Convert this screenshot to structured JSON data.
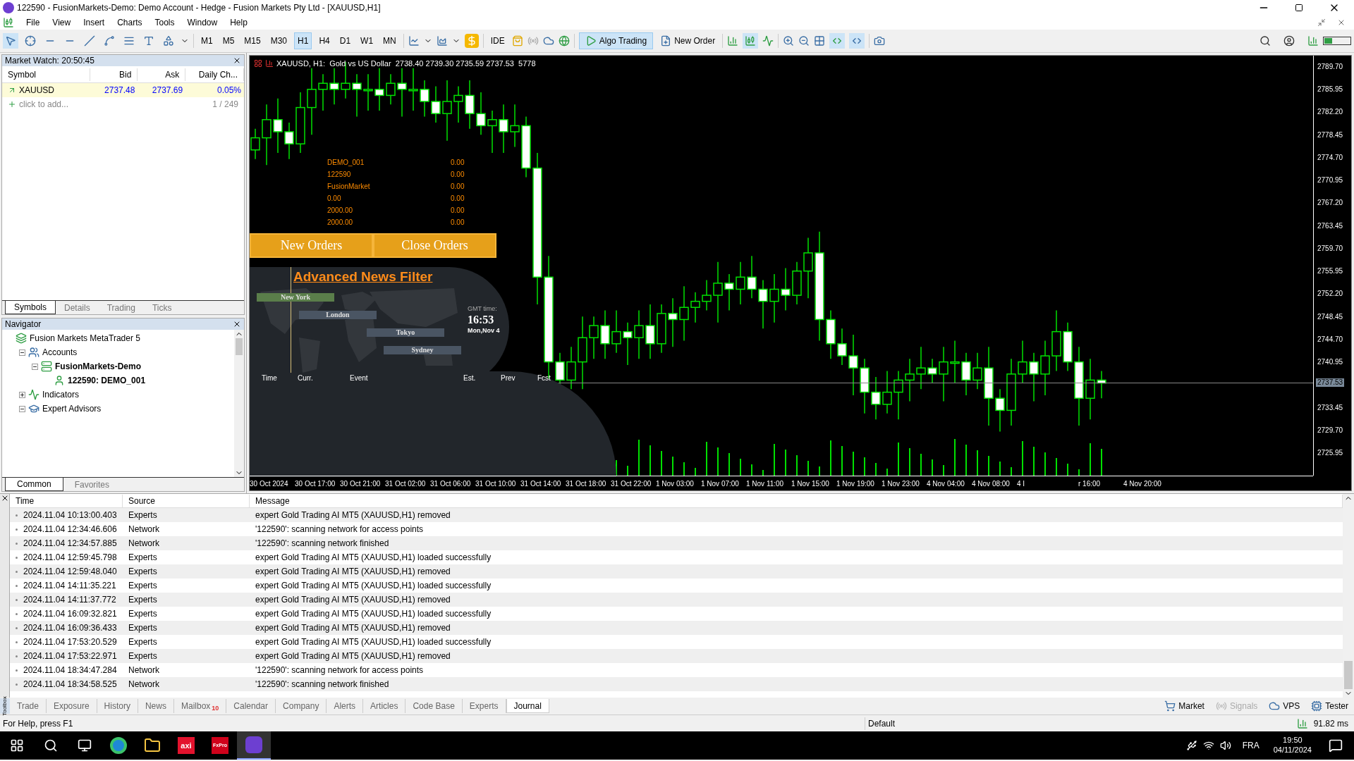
{
  "window": {
    "title": "122590 - FusionMarkets-Demo: Demo Account - Hedge - Fusion Markets Pty Ltd - [XAUUSD,H1]"
  },
  "menu": [
    "File",
    "View",
    "Insert",
    "Charts",
    "Tools",
    "Window",
    "Help"
  ],
  "toolbar": {
    "timeframes": [
      {
        "label": "M1",
        "selected": false
      },
      {
        "label": "M5",
        "selected": false
      },
      {
        "label": "M15",
        "selected": false
      },
      {
        "label": "M30",
        "selected": false
      },
      {
        "label": "H1",
        "selected": true
      },
      {
        "label": "H4",
        "selected": false
      },
      {
        "label": "D1",
        "selected": false
      },
      {
        "label": "W1",
        "selected": false
      },
      {
        "label": "MN",
        "selected": false
      }
    ],
    "ide": "IDE",
    "algo_trading": {
      "label": "Algo Trading",
      "on": true
    },
    "new_order": "New Order"
  },
  "market_watch": {
    "title": "Market Watch: 20:50:45",
    "columns": [
      "Symbol",
      "Bid",
      "Ask",
      "Daily Ch..."
    ],
    "rows": [
      {
        "symbol": "XAUUSD",
        "bid": "2737.48",
        "ask": "2737.69",
        "change": "0.05%"
      }
    ],
    "add_label": "click to add...",
    "count": "1 / 249",
    "tabs": [
      {
        "label": "Symbols",
        "selected": true
      },
      {
        "label": "Details",
        "selected": false
      },
      {
        "label": "Trading",
        "selected": false
      },
      {
        "label": "Ticks",
        "selected": false
      }
    ]
  },
  "navigator": {
    "title": "Navigator",
    "tree": [
      {
        "label": "Fusion Markets MetaTrader 5",
        "kind": "terminal",
        "bold": false
      },
      {
        "label": "Accounts",
        "kind": "accounts",
        "expanded": true,
        "bold": false,
        "children": [
          {
            "label": "FusionMarkets-Demo",
            "kind": "server",
            "expanded": true,
            "bold": true,
            "children": [
              {
                "label": "122590: DEMO_001",
                "kind": "account",
                "bold": true
              }
            ]
          }
        ]
      },
      {
        "label": "Indicators",
        "kind": "indicators",
        "expanded": false,
        "bold": false
      },
      {
        "label": "Expert Advisors",
        "kind": "experts",
        "expanded": true,
        "bold": false
      }
    ],
    "tabs": [
      {
        "label": "Common",
        "selected": true
      },
      {
        "label": "Favorites",
        "selected": false
      }
    ]
  },
  "chart": {
    "header": "XAUUSD, H1:  Gold vs US Dollar  2738.40 2739.30 2735.59 2737.53  5778",
    "panel_rows": [
      [
        "DEMO_001",
        "0.00"
      ],
      [
        "122590",
        "0.00"
      ],
      [
        "FusionMarket",
        "0.00"
      ],
      [
        "0.00",
        "0.00"
      ],
      [
        "2000.00",
        "0.00"
      ],
      [
        "2000.00",
        "0.00"
      ]
    ],
    "buttons": [
      "New Orders",
      "Close Orders"
    ],
    "news_filter": {
      "title": "Advanced News Filter",
      "sessions": [
        {
          "label": "New York",
          "active": true
        },
        {
          "label": "London",
          "active": false
        },
        {
          "label": "Tokyo",
          "active": false
        },
        {
          "label": "Sydney",
          "active": false
        }
      ],
      "gmt_label": "GMT time:",
      "time": "16:53",
      "date": "Mon,Nov 4",
      "columns": [
        "Time",
        "Curr.",
        "Event",
        "Est.",
        "Prev",
        "Fcst"
      ]
    },
    "price_axis": [
      "2789.70",
      "2785.95",
      "2782.20",
      "2778.45",
      "2774.70",
      "2770.95",
      "2767.20",
      "2763.45",
      "2759.70",
      "2755.95",
      "2752.20",
      "2748.45",
      "2744.70",
      "2740.95",
      "2733.45",
      "2729.70",
      "2725.95"
    ],
    "current_price": "2737.53",
    "time_axis": [
      "30 Oct 2024",
      "30 Oct 17:00",
      "30 Oct 21:00",
      "31 Oct 02:00",
      "31 Oct 06:00",
      "31 Oct 10:00",
      "31 Oct 14:00",
      "31 Oct 18:00",
      "31 Oct 22:00",
      "1 Nov 03:00",
      "1 Nov 07:00",
      "1 Nov 11:00",
      "1 Nov 15:00",
      "1 Nov 19:00",
      "1 Nov 23:00",
      "4 Nov 04:00",
      "4 Nov 08:00",
      "4 I"
    ],
    "time_axis_tail": [
      "r 16:00",
      "4 Nov 20:00"
    ]
  },
  "journal": {
    "columns": [
      "Time",
      "Source",
      "Message"
    ],
    "rows": [
      {
        "time": "2024.11.04 10:13:00.403",
        "source": "Experts",
        "message": "expert Gold Trading AI MT5 (XAUUSD,H1) removed"
      },
      {
        "time": "2024.11.04 12:34:46.606",
        "source": "Network",
        "message": "'122590': scanning network for access points"
      },
      {
        "time": "2024.11.04 12:34:57.885",
        "source": "Network",
        "message": "'122590': scanning network finished"
      },
      {
        "time": "2024.11.04 12:59:45.798",
        "source": "Experts",
        "message": "expert Gold Trading AI MT5 (XAUUSD,H1) loaded successfully"
      },
      {
        "time": "2024.11.04 12:59:48.040",
        "source": "Experts",
        "message": "expert Gold Trading AI MT5 (XAUUSD,H1) removed"
      },
      {
        "time": "2024.11.04 14:11:35.221",
        "source": "Experts",
        "message": "expert Gold Trading AI MT5 (XAUUSD,H1) loaded successfully"
      },
      {
        "time": "2024.11.04 14:11:37.772",
        "source": "Experts",
        "message": "expert Gold Trading AI MT5 (XAUUSD,H1) removed"
      },
      {
        "time": "2024.11.04 16:09:32.821",
        "source": "Experts",
        "message": "expert Gold Trading AI MT5 (XAUUSD,H1) loaded successfully"
      },
      {
        "time": "2024.11.04 16:09:36.433",
        "source": "Experts",
        "message": "expert Gold Trading AI MT5 (XAUUSD,H1) removed"
      },
      {
        "time": "2024.11.04 17:53:20.529",
        "source": "Experts",
        "message": "expert Gold Trading AI MT5 (XAUUSD,H1) loaded successfully"
      },
      {
        "time": "2024.11.04 17:53:22.971",
        "source": "Experts",
        "message": "expert Gold Trading AI MT5 (XAUUSD,H1) removed"
      },
      {
        "time": "2024.11.04 18:34:47.284",
        "source": "Network",
        "message": "'122590': scanning network for access points"
      },
      {
        "time": "2024.11.04 18:34:58.525",
        "source": "Network",
        "message": "'122590': scanning network finished"
      }
    ]
  },
  "toolbox": {
    "label": "Toolbox",
    "tabs": [
      {
        "label": "Trade",
        "selected": false
      },
      {
        "label": "Exposure",
        "selected": false
      },
      {
        "label": "History",
        "selected": false
      },
      {
        "label": "News",
        "selected": false
      },
      {
        "label": "Mailbox",
        "badge": "10",
        "selected": false
      },
      {
        "label": "Calendar",
        "selected": false
      },
      {
        "label": "Company",
        "selected": false
      },
      {
        "label": "Alerts",
        "selected": false
      },
      {
        "label": "Articles",
        "selected": false
      },
      {
        "label": "Code Base",
        "selected": false
      },
      {
        "label": "Experts",
        "selected": false
      },
      {
        "label": "Journal",
        "selected": true
      }
    ],
    "services": [
      {
        "label": "Market",
        "kind": "market",
        "disabled": false
      },
      {
        "label": "Signals",
        "kind": "signals",
        "disabled": true
      },
      {
        "label": "VPS",
        "kind": "vps",
        "disabled": false
      },
      {
        "label": "Tester",
        "kind": "tester",
        "disabled": false
      }
    ]
  },
  "status_bar": {
    "help": "For Help, press F1",
    "profile": "Default",
    "ping": "91.82 ms"
  },
  "taskbar": {
    "apps": [
      {
        "label": "axi",
        "kind": "axi"
      },
      {
        "label": "FxPro",
        "kind": "fxpro"
      }
    ],
    "language": "FRA",
    "time": "19:50",
    "date": "04/11/2024"
  }
}
